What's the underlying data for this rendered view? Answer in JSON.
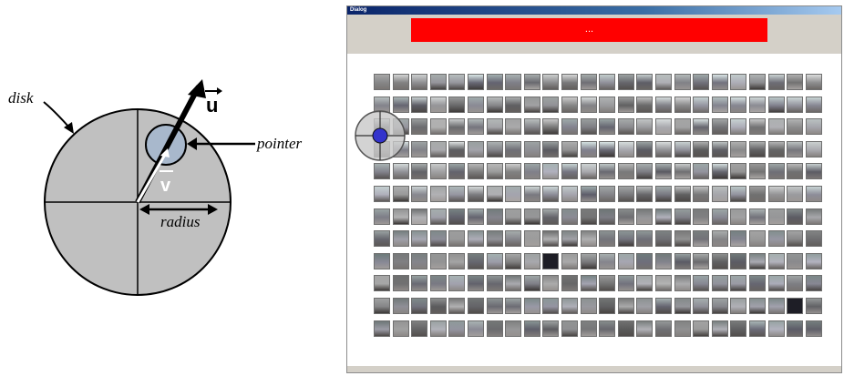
{
  "figure": {
    "labels": {
      "disk": "disk",
      "pointer": "pointer",
      "radius": "radius",
      "u_vector": "u",
      "v_vector": "v"
    },
    "colors": {
      "disk_fill": "#c0c0c0",
      "pointer_fill": "#a8b8cc"
    }
  },
  "dialog": {
    "title": "Dialog",
    "progress_text": "...",
    "progress_color": "#ff0000",
    "grid": {
      "rows": 12,
      "columns": 24
    },
    "cursor": {
      "icon": "circular-crosshair-pointer",
      "colors": {
        "outer": "#c8c8c8",
        "inner": "#3333cc"
      }
    }
  }
}
